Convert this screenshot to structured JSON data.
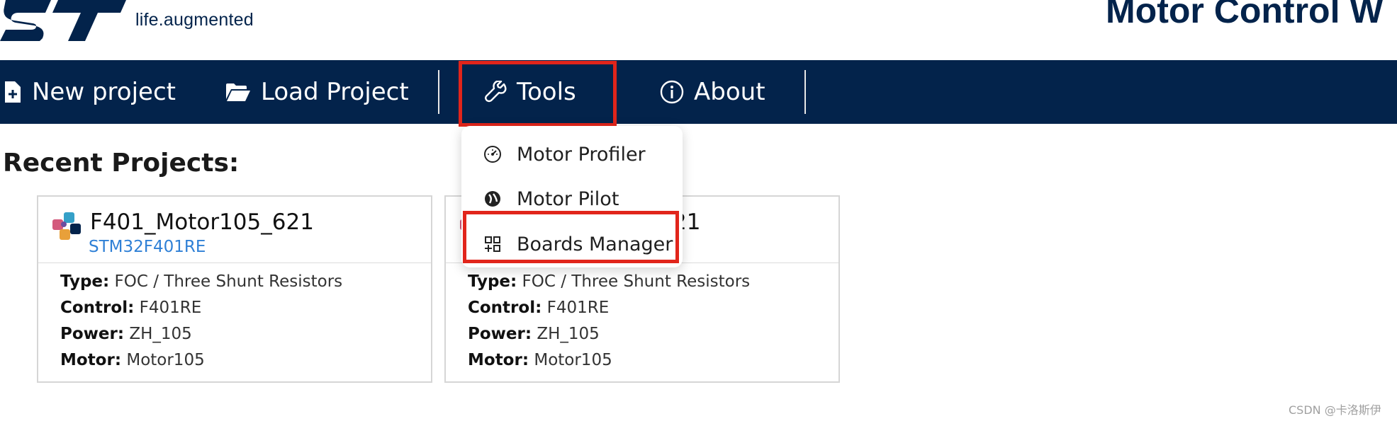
{
  "header": {
    "tagline": "life.augmented",
    "app_title": "Motor Control W"
  },
  "nav": {
    "new_project": "New project",
    "load_project": "Load Project",
    "tools": "Tools",
    "about": "About"
  },
  "tools_menu": {
    "items": [
      {
        "label": "Motor Profiler",
        "icon": "gauge-icon"
      },
      {
        "label": "Motor Pilot",
        "icon": "pilot-icon"
      },
      {
        "label": "Boards Manager",
        "icon": "boards-grid-icon"
      }
    ]
  },
  "recent": {
    "title": "Recent Projects:",
    "cards": [
      {
        "name": "F401_Motor105_621",
        "mcu": "STM32F401RE",
        "type_label": "Type:",
        "type": "FOC / Three Shunt Resistors",
        "control_label": "Control:",
        "control": "F401RE",
        "power_label": "Power:",
        "power": "ZH_105",
        "motor_label": "Motor:",
        "motor": "Motor105"
      },
      {
        "name_visible": "21",
        "type_label": "Type:",
        "type": "FOC / Three Shunt Resistors",
        "control_label": "Control:",
        "control": "F401RE",
        "power_label": "Power:",
        "power": "ZH_105",
        "motor_label": "Motor:",
        "motor": "Motor105"
      }
    ]
  },
  "watermark": "CSDN @卡洛斯伊",
  "colors": {
    "navbar": "#03234b",
    "highlight": "#e1251b",
    "link": "#2f80d6"
  }
}
